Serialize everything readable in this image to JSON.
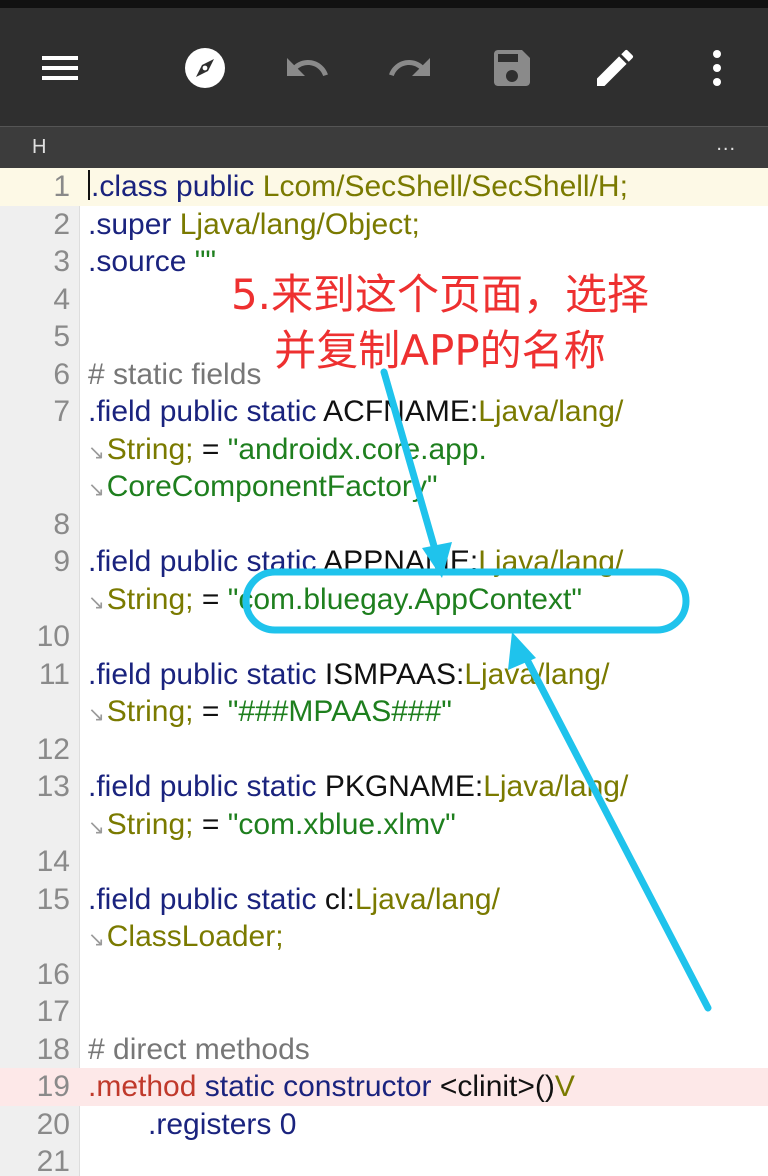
{
  "toolbar": {
    "icons": [
      "menu-icon",
      "compass-icon",
      "undo-icon",
      "redo-icon",
      "save-icon",
      "edit-icon",
      "more-vert-icon"
    ]
  },
  "tab": {
    "label": "H",
    "more": "..."
  },
  "editor": {
    "lines": [
      {
        "n": "1",
        "kind": "class"
      },
      {
        "n": "2",
        "kind": "super"
      },
      {
        "n": "3",
        "kind": "source"
      },
      {
        "n": "4"
      },
      {
        "n": "5"
      },
      {
        "n": "6",
        "kind": "comment1"
      },
      {
        "n": "7",
        "kind": "field1"
      },
      {
        "n": "8"
      },
      {
        "n": "9",
        "kind": "field2"
      },
      {
        "n": "10"
      },
      {
        "n": "11",
        "kind": "field3"
      },
      {
        "n": "12"
      },
      {
        "n": "13",
        "kind": "field4"
      },
      {
        "n": "14"
      },
      {
        "n": "15",
        "kind": "field5"
      },
      {
        "n": "16"
      },
      {
        "n": "17"
      },
      {
        "n": "18",
        "kind": "comment2"
      },
      {
        "n": "19",
        "kind": "method"
      },
      {
        "n": "20",
        "kind": "registers"
      },
      {
        "n": "21"
      }
    ],
    "text": {
      "class_dir": ".class",
      "public": "public",
      "class_name": "Lcom/SecShell/SecShell/H;",
      "super_dir": ".super",
      "super_type": "Ljava/lang/Object;",
      "source_dir": ".source",
      "source_val": "\"\"",
      "comment_static": "# static fields",
      "field_dir": ".field",
      "static": "static",
      "acf_name": "ACFNAME:",
      "type_lang": "Ljava/lang/",
      "type_string": "String;",
      "eq": "=",
      "acf_val1": "\"androidx.core.app.",
      "acf_val2": "CoreComponentFactory\"",
      "app_name": "APPNAME:",
      "app_val": "\"com.bluegay.AppContext\"",
      "ismpaas_name": "ISMPAAS:",
      "ismpaas_val": "\"###MPAAS###\"",
      "pkg_name": "PKGNAME:",
      "pkg_val": "\"com.xblue.xlmv\"",
      "cl_name": "cl:",
      "classloader": "ClassLoader;",
      "comment_direct": "# direct methods",
      "method_dir": ".method",
      "constructor": "constructor",
      "clinit": "<clinit>()",
      "void_type": "V",
      "registers_dir": ".registers",
      "registers_val": "0"
    }
  },
  "annotation": {
    "line1": "5.来到这个页面，选择",
    "line2": "并复制APP的名称",
    "color": "#ee3030",
    "highlight_color": "#1fc3ec"
  }
}
